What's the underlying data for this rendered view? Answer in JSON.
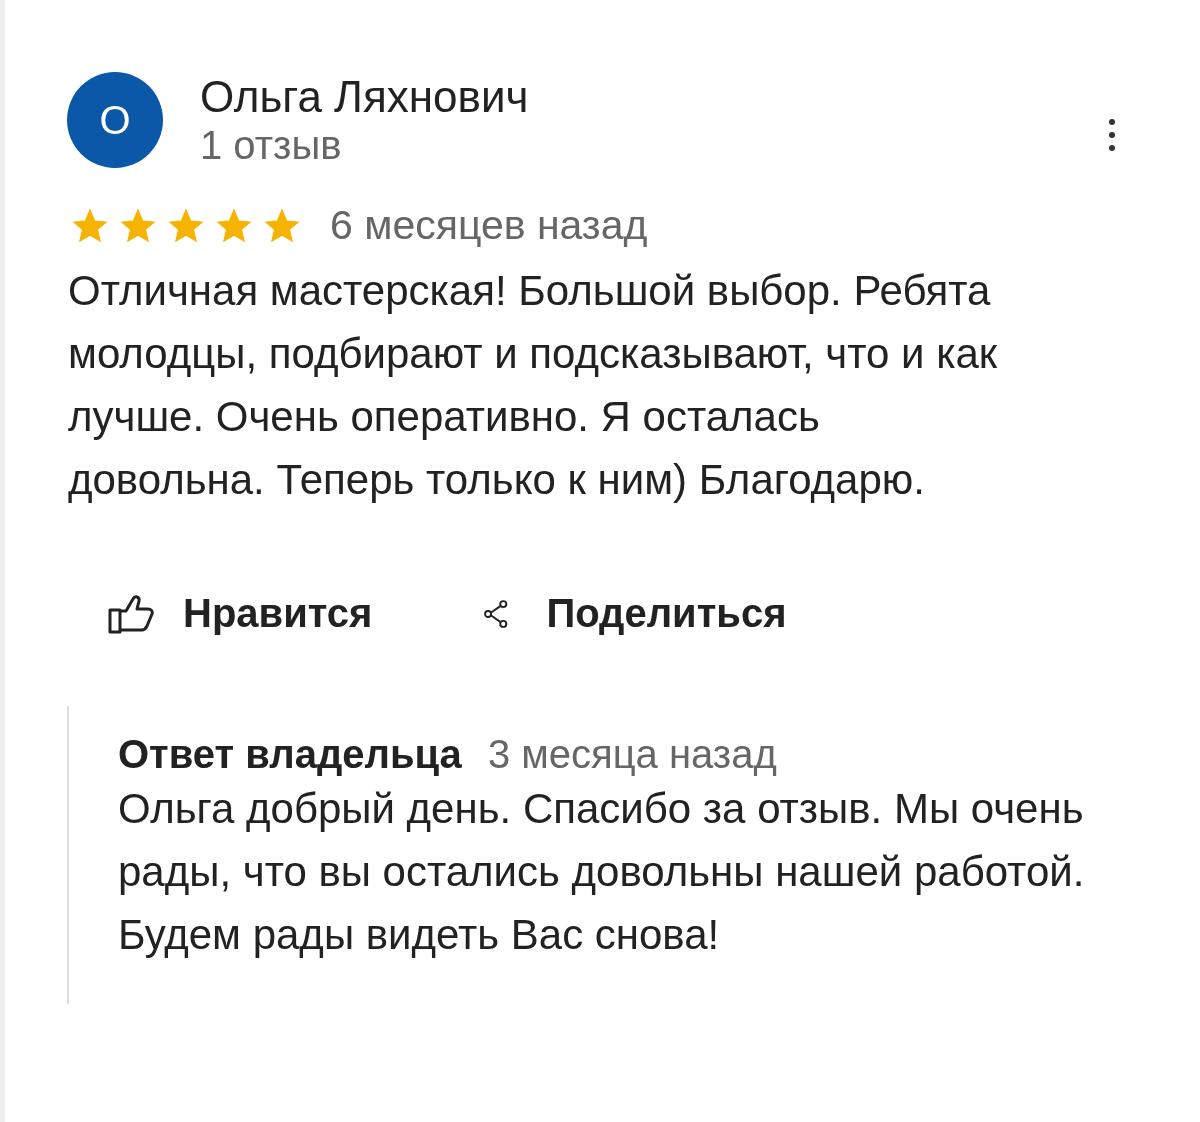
{
  "author": {
    "avatar_letter": "О",
    "name": "Ольга Ляхнович",
    "review_count": "1 отзыв"
  },
  "review": {
    "stars": 5,
    "time": "6 месяцев назад",
    "text": "Отличная мастерская! Большой выбор. Ребята молодцы, подбирают и подсказывают, что и как лучше. Очень оперативно. Я осталась довольна. Теперь только к ним) Благодарю."
  },
  "actions": [
    {
      "kind": "like",
      "label": "Нравится"
    },
    {
      "kind": "share",
      "label": "Поделиться"
    }
  ],
  "owner_reply": {
    "label": "Ответ владельца",
    "time": "3 месяца назад",
    "text": "Ольга добрый день. Спасибо за отзыв. Мы очень рады, что вы остались довольны нашей работой. Будем рады видеть Вас снова!"
  }
}
